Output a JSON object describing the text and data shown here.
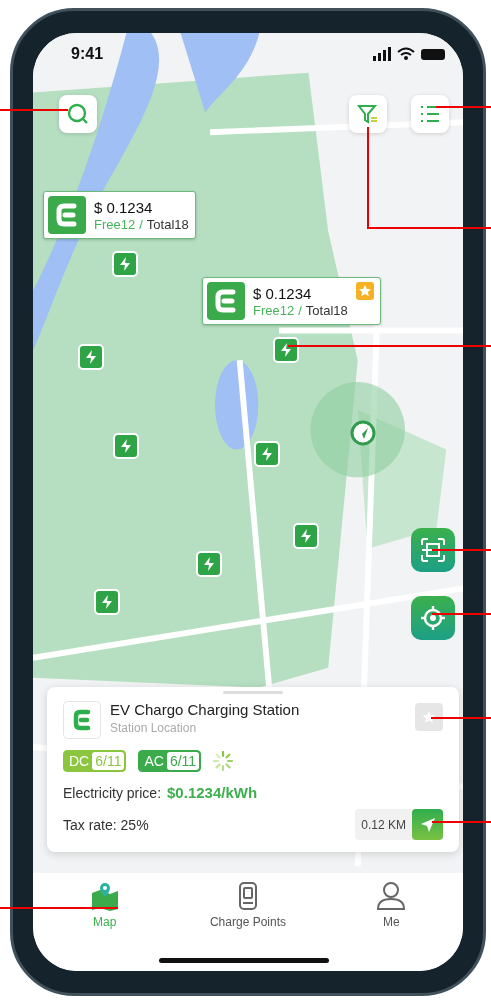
{
  "status_bar": {
    "time": "9:41"
  },
  "map_callouts": [
    {
      "price": "$ 0.1234",
      "free": "Free12",
      "separator": "/",
      "total": "Total18",
      "favorite": false
    },
    {
      "price": "$ 0.1234",
      "free": "Free12",
      "separator": "/",
      "total": "Total18",
      "favorite": true
    }
  ],
  "station_card": {
    "name": "EV Chargo Charging Station",
    "subtitle": "Station Location",
    "favorite": false,
    "connectors": [
      {
        "type": "DC",
        "available": "6/11",
        "color": "#8cc63f"
      },
      {
        "type": "AC",
        "available": "6/11",
        "color": "#3aaa4a"
      }
    ],
    "price_label": "Electricity price:",
    "price": "$0.1234/kWh",
    "tax": "Tax rate: 25%",
    "distance": "0.12 KM"
  },
  "tabs": [
    {
      "label": "Map",
      "selected": true
    },
    {
      "label": "Charge Points",
      "selected": false
    },
    {
      "label": "Me",
      "selected": false
    }
  ]
}
